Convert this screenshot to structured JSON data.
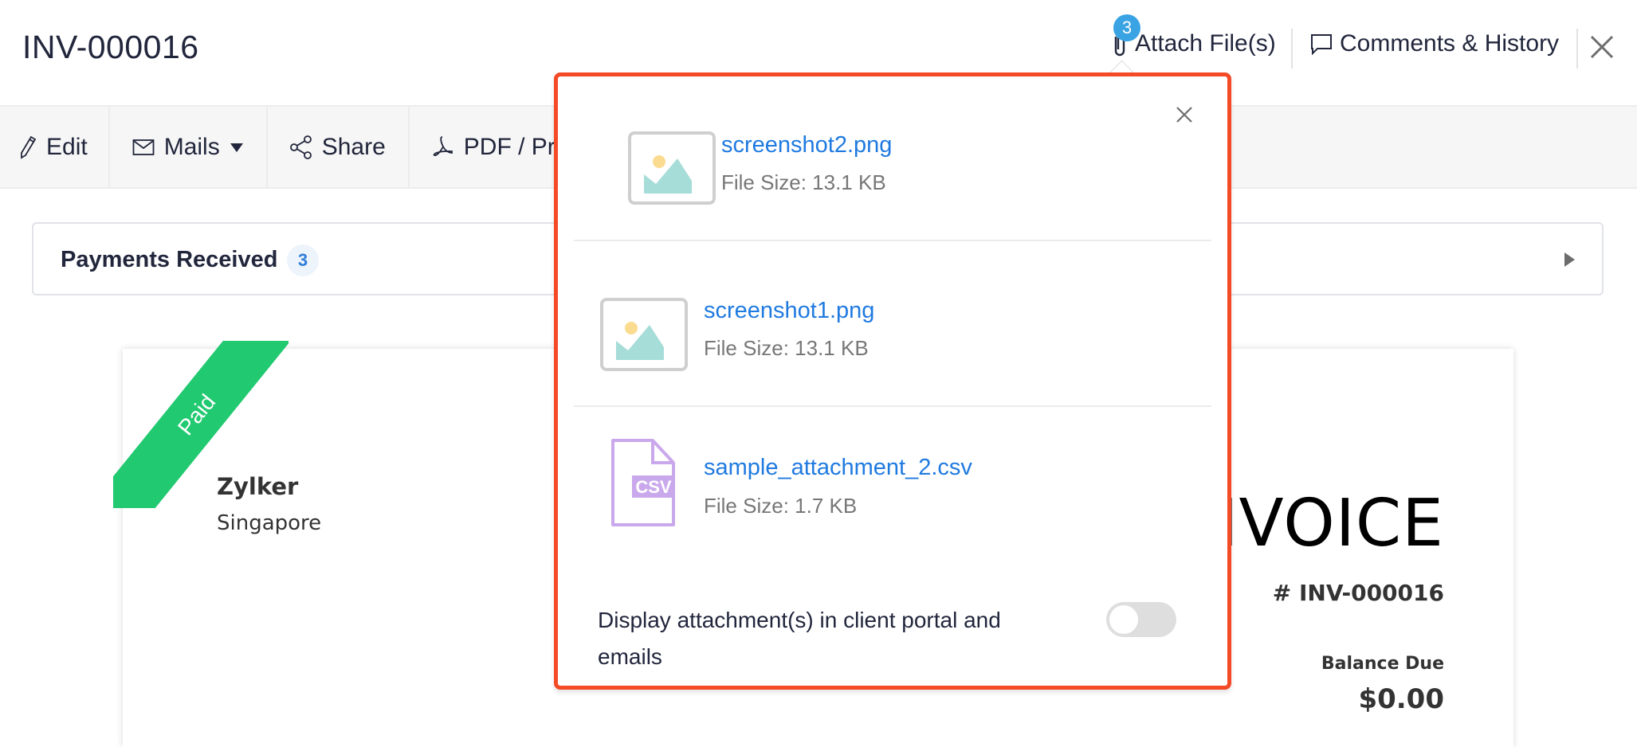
{
  "header": {
    "title": "INV-000016",
    "attach_label": "Attach File(s)",
    "attach_count": "3",
    "comments_label": "Comments & History"
  },
  "toolbar": {
    "items": [
      {
        "label": "Edit",
        "icon": "pencil-icon"
      },
      {
        "label": "Mails",
        "icon": "mail-icon",
        "dropdown": true
      },
      {
        "label": "Share",
        "icon": "share-icon"
      },
      {
        "label": "PDF / Print",
        "icon": "pdf-icon"
      }
    ]
  },
  "payments": {
    "label": "Payments Received",
    "count": "3"
  },
  "invoice": {
    "status_ribbon": "Paid",
    "org_name": "Zylker",
    "org_location": "Singapore",
    "heading": "INVOICE",
    "number": "# INV-000016",
    "balance_label": "Balance Due",
    "balance_value": "$0.00"
  },
  "attachments_popup": {
    "files": [
      {
        "name": "screenshot2.png",
        "size": "File Size: 13.1 KB",
        "type": "image"
      },
      {
        "name": "screenshot1.png",
        "size": "File Size: 13.1 KB",
        "type": "image"
      },
      {
        "name": "sample_attachment_2.csv",
        "size": "File Size: 1.7 KB",
        "type": "csv",
        "badge": "CSV"
      }
    ],
    "toggle_label": "Display attachment(s) in client portal and emails",
    "toggle_on": false
  },
  "colors": {
    "accent_link": "#1f7ae0",
    "badge_blue": "#3aa3e3",
    "paid_green": "#21c970",
    "highlight_border": "#f44a26"
  }
}
